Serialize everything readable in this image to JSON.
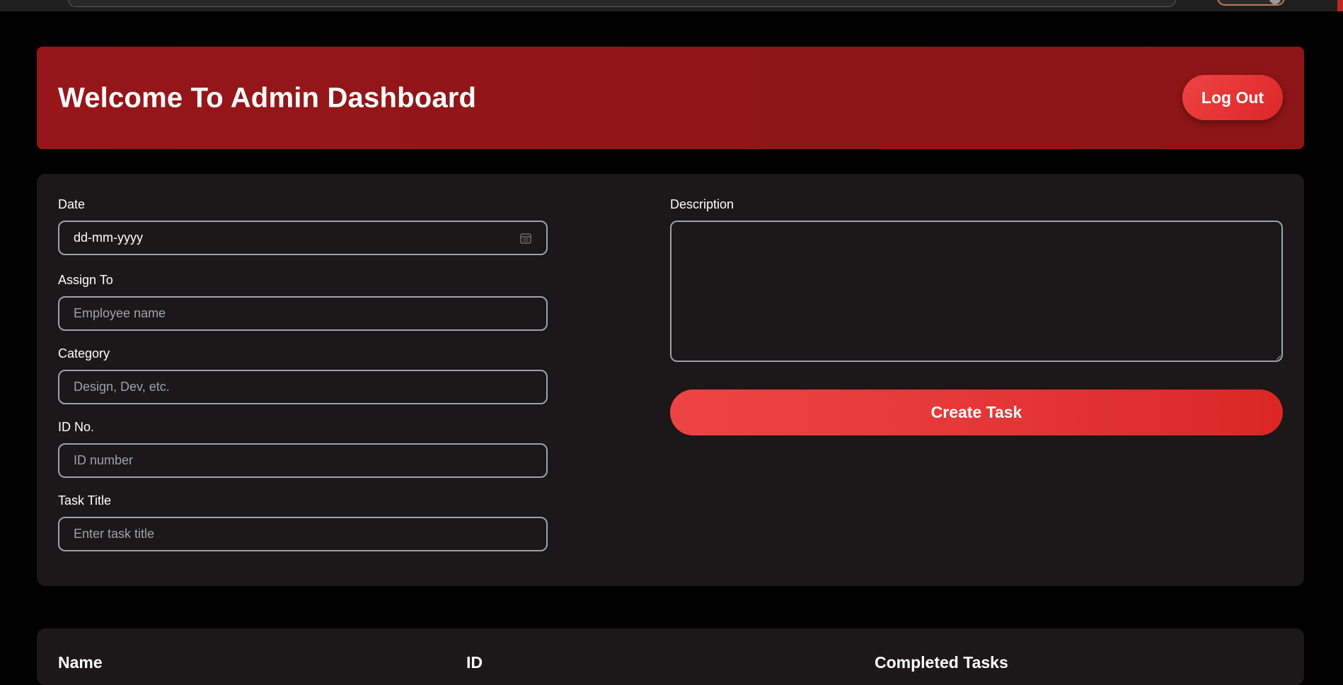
{
  "header": {
    "title": "Welcome To Admin Dashboard",
    "logout_label": "Log Out"
  },
  "form": {
    "date": {
      "label": "Date",
      "value": "dd-mm-yyyy"
    },
    "assign_to": {
      "label": "Assign To",
      "placeholder": "Employee name"
    },
    "category": {
      "label": "Category",
      "placeholder": "Design, Dev, etc."
    },
    "id_no": {
      "label": "ID No.",
      "placeholder": "ID number"
    },
    "task_title": {
      "label": "Task Title",
      "placeholder": "Enter task title"
    },
    "description": {
      "label": "Description",
      "value": ""
    },
    "create_label": "Create Task"
  },
  "table": {
    "headers": [
      "Name",
      "ID",
      "Completed Tasks"
    ]
  },
  "colors": {
    "header_bg": "#8f1618",
    "accent": "#ef4444",
    "accent_dark": "#dc2626",
    "card_bg": "#1c1718",
    "page_bg": "#000000",
    "input_border": "#9ca3af"
  },
  "icons": {
    "date_picker": "calendar-icon"
  }
}
